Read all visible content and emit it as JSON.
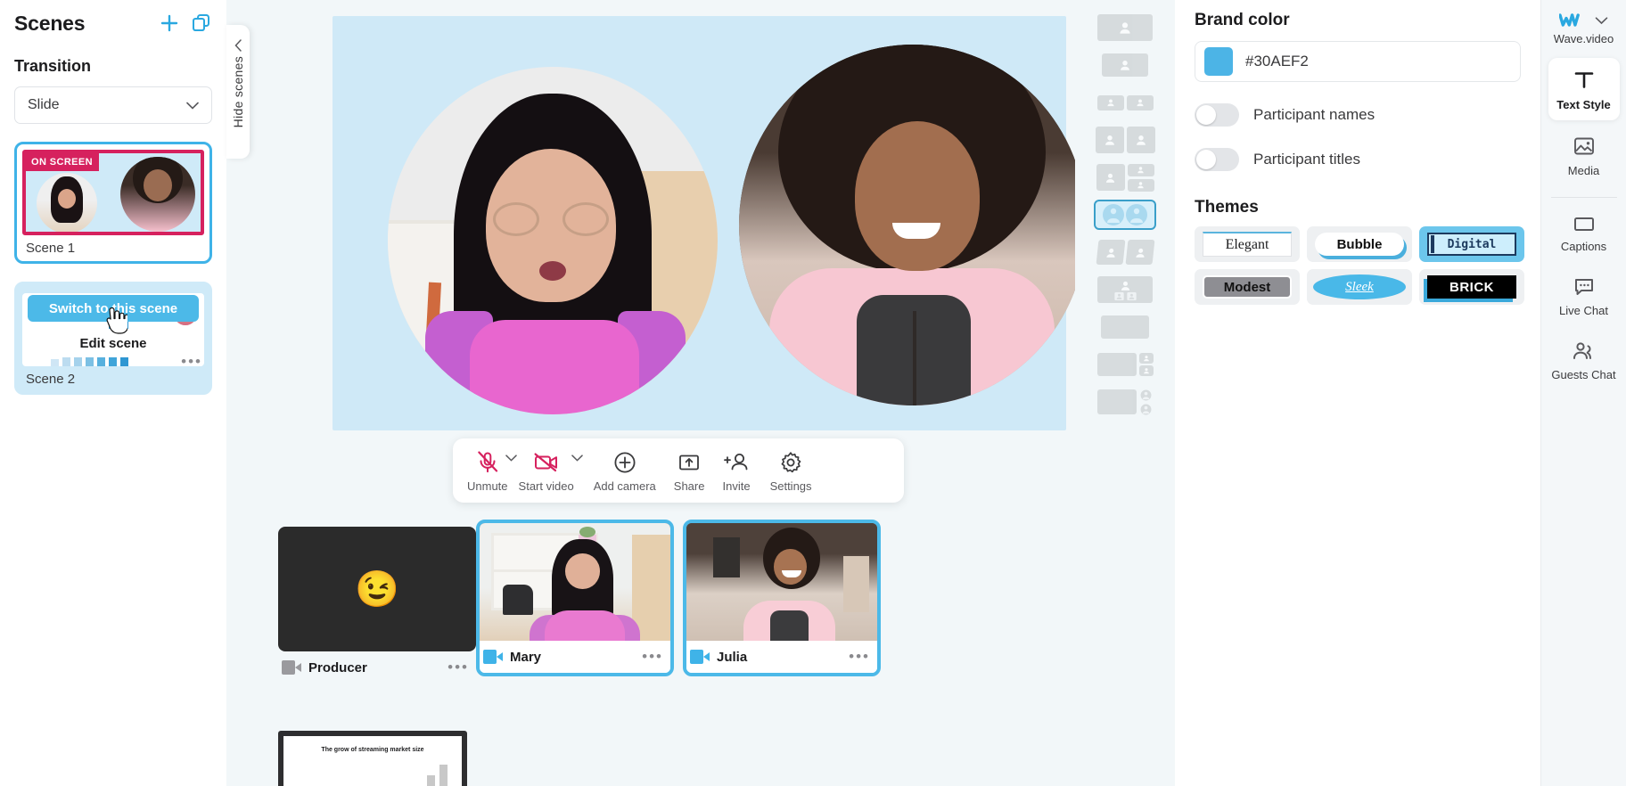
{
  "scenes_panel": {
    "title": "Scenes",
    "add_icon": "plus-icon",
    "duplicate_icon": "duplicate-icon",
    "transition_label": "Transition",
    "transition_value": "Slide",
    "scenes": [
      {
        "name": "Scene 1",
        "badge": "ON SCREEN",
        "active": true
      },
      {
        "name": "Scene 2",
        "switch_label": "Switch to this scene",
        "edit_label": "Edit scene",
        "active": false
      }
    ]
  },
  "hide_scenes": {
    "label": "Hide scenes"
  },
  "toolbar": {
    "items": [
      {
        "label": "Unmute",
        "icon": "mic-off-icon",
        "has_caret": true,
        "state": "off"
      },
      {
        "label": "Start video",
        "icon": "video-off-icon",
        "has_caret": true,
        "state": "off"
      },
      {
        "label": "Add camera",
        "icon": "plus-circle-icon",
        "has_caret": false,
        "state": "on"
      },
      {
        "label": "Share",
        "icon": "share-screen-icon",
        "has_caret": false,
        "state": "on"
      },
      {
        "label": "Invite",
        "icon": "add-person-icon",
        "has_caret": false,
        "state": "on"
      },
      {
        "label": "Settings",
        "icon": "gear-icon",
        "has_caret": false,
        "state": "on"
      }
    ]
  },
  "participants": [
    {
      "name": "Producer",
      "selected": false,
      "camera_on": false,
      "placeholder": "wink-emoji",
      "menu": "•••"
    },
    {
      "name": "Mary",
      "selected": true,
      "camera_on": true,
      "menu": "•••"
    },
    {
      "name": "Julia",
      "selected": true,
      "camera_on": true,
      "menu": "•••"
    }
  ],
  "slide_thumb": {
    "title": "The grow of streaming market size"
  },
  "layouts": {
    "selected_index": 5,
    "items": [
      "layout-single-fill",
      "layout-single-center",
      "layout-two-small-side-by-side",
      "layout-two-equal",
      "layout-one-plus-two",
      "layout-two-circles",
      "layout-two-tilted",
      "layout-one-over-two",
      "layout-blank",
      "layout-main-plus-two-right",
      "layout-main-plus-two-badges"
    ]
  },
  "settings": {
    "brand_color_title": "Brand color",
    "brand_color_hex": "#30AEF2",
    "toggles": [
      {
        "label": "Participant names",
        "on": false
      },
      {
        "label": "Participant titles",
        "on": false
      }
    ],
    "themes_title": "Themes",
    "themes": [
      {
        "label": "Elegant",
        "selected": false
      },
      {
        "label": "Bubble",
        "selected": false
      },
      {
        "label": "Digital",
        "selected": true
      },
      {
        "label": "Modest",
        "selected": false
      },
      {
        "label": "Sleek",
        "selected": false
      },
      {
        "label": "BRICK",
        "selected": false
      }
    ]
  },
  "tool_rail": {
    "brand": {
      "label": "Wave.video",
      "logo_icon": "wave-logo-icon",
      "chevron_icon": "chevron-down-icon"
    },
    "items": [
      {
        "label": "Text Style",
        "icon": "text-style-icon",
        "active": true
      },
      {
        "label": "Media",
        "icon": "media-image-icon",
        "active": false
      },
      {
        "label": "Captions",
        "icon": "captions-icon",
        "active": false
      },
      {
        "label": "Live Chat",
        "icon": "live-chat-icon",
        "active": false
      },
      {
        "label": "Guests Chat",
        "icon": "guests-chat-icon",
        "active": false
      }
    ]
  },
  "colors": {
    "accent": "#4cb9e8",
    "onscreen": "#d6215e",
    "stage_bg": "#f2f7f9",
    "preview_bg": "#cfe9f7"
  }
}
